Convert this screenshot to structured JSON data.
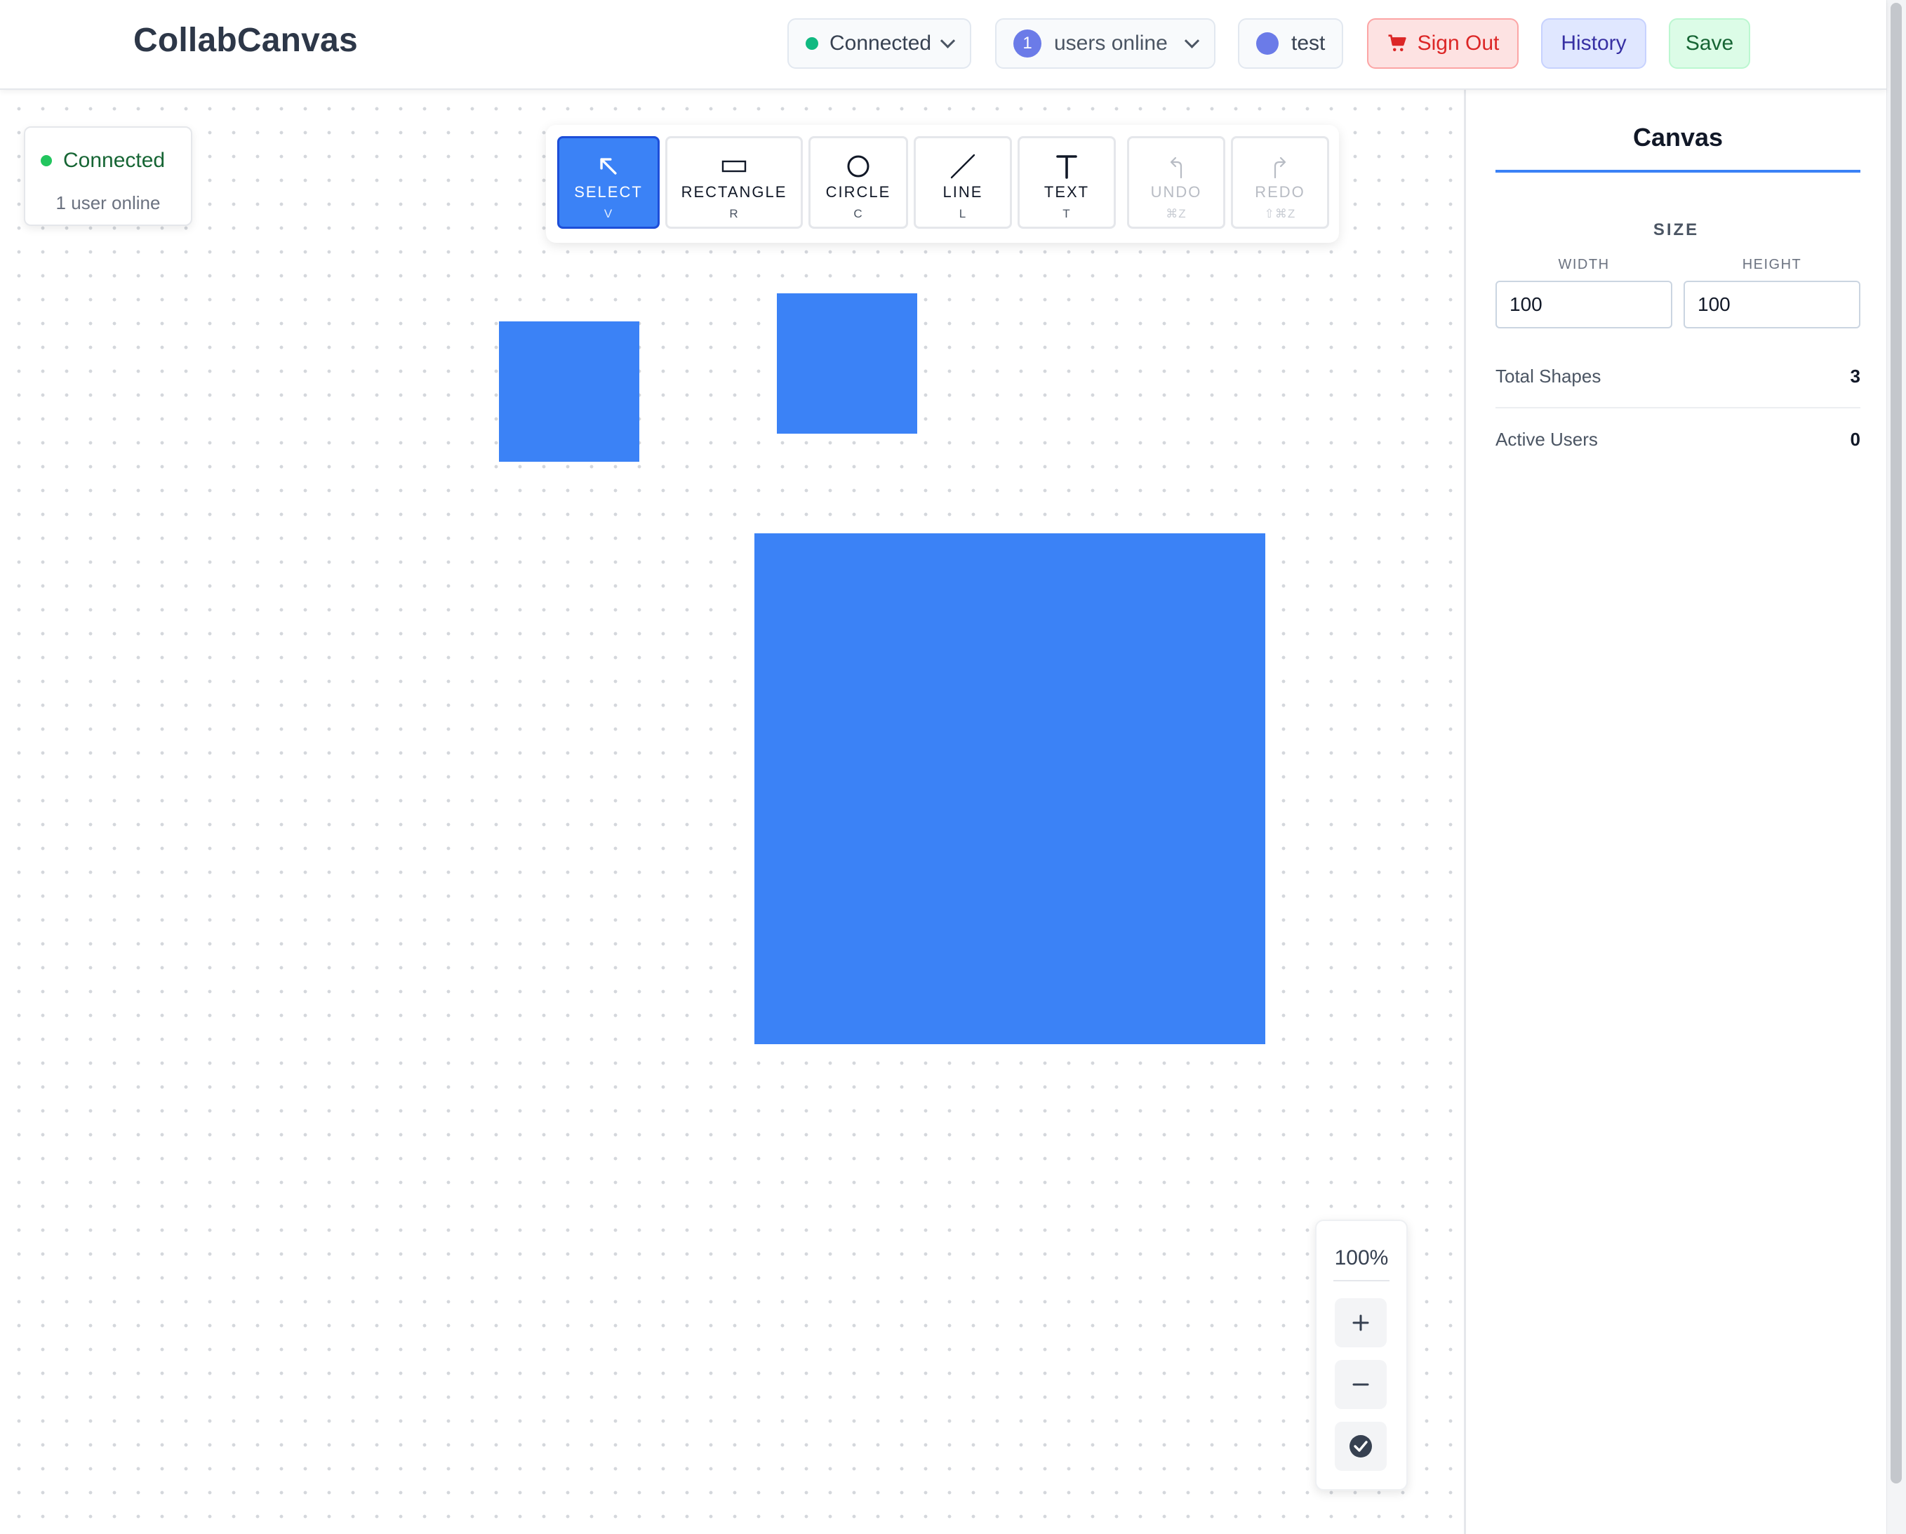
{
  "header": {
    "title": "CollabCanvas",
    "status_label": "Connected",
    "users_count": "1",
    "users_label": "users online",
    "user_name": "test",
    "signout_label": "Sign Out",
    "history_label": "History",
    "save_label": "Save"
  },
  "connection_card": {
    "status": "Connected",
    "users": "1 user online"
  },
  "toolbar": {
    "tools": [
      {
        "label": "SELECT",
        "key": "V",
        "icon": "arrow-up-left-icon",
        "state": "active"
      },
      {
        "label": "RECTANGLE",
        "key": "R",
        "icon": "rectangle-icon",
        "state": "normal"
      },
      {
        "label": "CIRCLE",
        "key": "C",
        "icon": "circle-icon",
        "state": "normal"
      },
      {
        "label": "LINE",
        "key": "L",
        "icon": "line-icon",
        "state": "normal"
      },
      {
        "label": "TEXT",
        "key": "T",
        "icon": "text-icon",
        "state": "normal"
      },
      {
        "label": "UNDO",
        "key": "⌘Z",
        "icon": "undo-icon",
        "state": "disabled"
      },
      {
        "label": "REDO",
        "key": "⇧⌘Z",
        "icon": "redo-icon",
        "state": "disabled"
      }
    ]
  },
  "canvas": {
    "shape_color": "#3b82f6",
    "shape_type": "rectangle"
  },
  "zoom": {
    "level": "100%"
  },
  "panel": {
    "tab": "Canvas",
    "size_title": "SIZE",
    "width_label": "WIDTH",
    "width_value": "100",
    "height_label": "HEIGHT",
    "height_value": "100",
    "stats": [
      {
        "label": "Total Shapes",
        "value": "3"
      },
      {
        "label": "Active Users",
        "value": "0"
      }
    ]
  },
  "colors": {
    "accent": "#3b82f6",
    "connected": "#10b981",
    "danger": "#dc2626"
  }
}
